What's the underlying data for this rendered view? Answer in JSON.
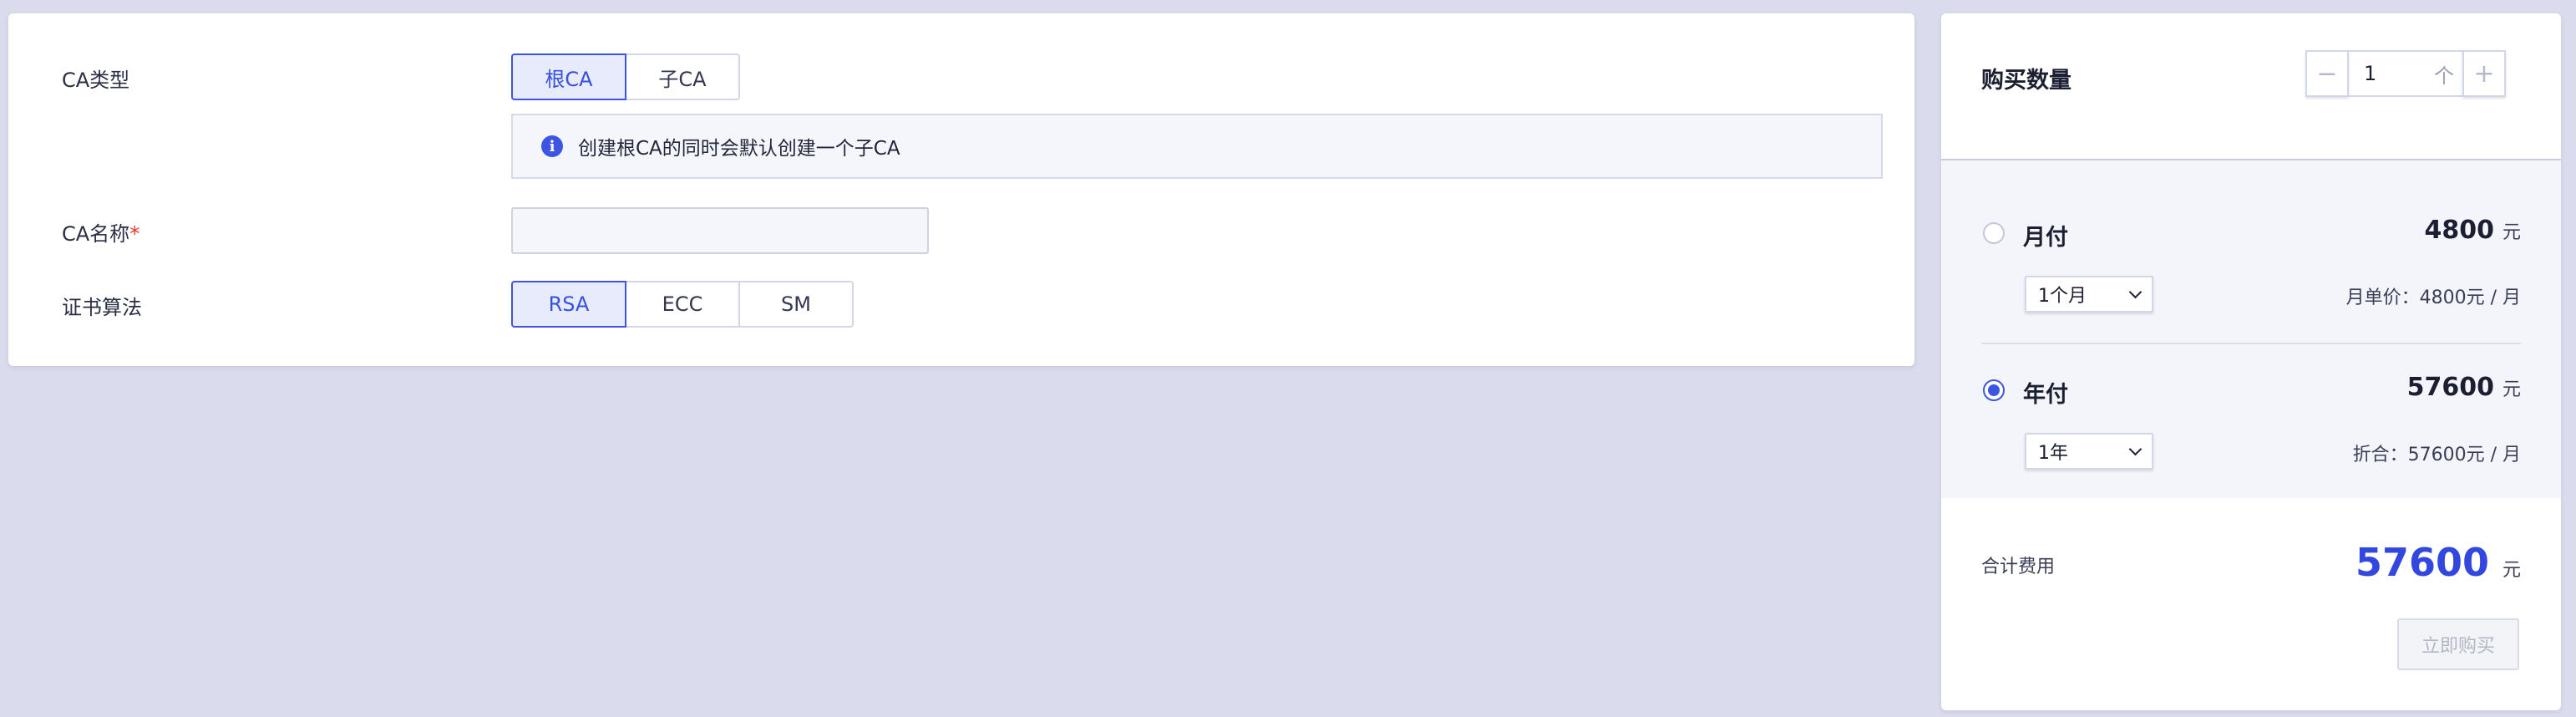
{
  "config": {
    "ca_type": {
      "label": "CA类型",
      "options": [
        "根CA",
        "子CA"
      ],
      "selected": "根CA",
      "notice": "创建根CA的同时会默认创建一个子CA"
    },
    "ca_name": {
      "label": "CA名称",
      "required_mark": "*",
      "value": "",
      "placeholder": ""
    },
    "algorithm": {
      "label": "证书算法",
      "options": [
        "RSA",
        "ECC",
        "SM"
      ],
      "selected": "RSA"
    }
  },
  "purchase": {
    "quantity_label": "购买数量",
    "minus": "−",
    "plus": "+",
    "quantity_value": "1",
    "quantity_unit": "个",
    "plans": [
      {
        "name": "月付",
        "price": "4800",
        "currency": "元",
        "duration": "1个月",
        "unit_price": "月单价：4800元 / 月",
        "checked": false
      },
      {
        "name": "年付",
        "price": "57600",
        "currency": "元",
        "duration": "1年",
        "unit_price": "折合：57600元 / 月",
        "checked": true
      }
    ],
    "total_label": "合计费用",
    "total_value": "57600",
    "total_currency": "元",
    "buy_button": "立即购买"
  },
  "colors": {
    "accent": "#3d55e2",
    "total": "#3147e0",
    "background": "#dadced",
    "required": "#e0362f"
  },
  "icons": {
    "notice": "info-icon",
    "select": "chevron-down-icon"
  }
}
